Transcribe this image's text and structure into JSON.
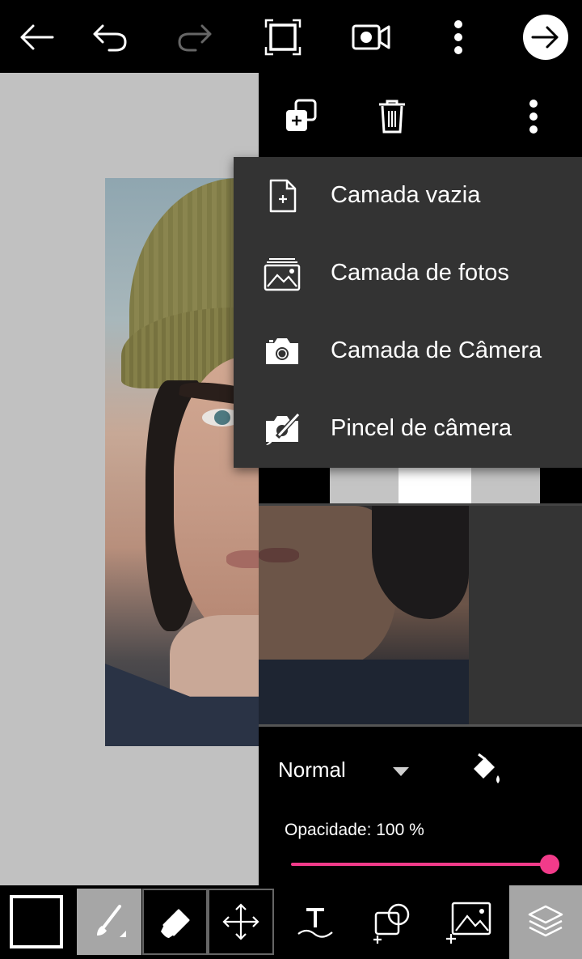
{
  "toolbar": {
    "back": "back-arrow-icon",
    "undo": "undo-icon",
    "redo": "redo-icon",
    "fullscreen": "fullscreen-icon",
    "record": "video-record-icon",
    "more": "more-vertical-icon",
    "next": "next-arrow-icon"
  },
  "layer_toolbar": {
    "add_layer": "add-layer-icon",
    "delete_layer": "trash-icon",
    "more": "more-vertical-icon"
  },
  "menu": {
    "items": [
      {
        "label": "Camada vazia",
        "icon": "blank-file-plus-icon"
      },
      {
        "label": "Camada de fotos",
        "icon": "photo-icon"
      },
      {
        "label": "Camada de Câmera",
        "icon": "camera-icon"
      },
      {
        "label": "Pincel de câmera",
        "icon": "camera-brush-icon"
      }
    ]
  },
  "blend": {
    "mode": "Normal",
    "fill_icon": "paint-bucket-icon"
  },
  "opacity": {
    "label": "Opacidade: 100 %",
    "value": 100
  },
  "colors": {
    "accent": "#f23b8a",
    "menu_bg": "#333333",
    "canvas_bg": "#c1c1c1",
    "active_tool_bg": "#a6a6a6",
    "primary_color": "#000000"
  },
  "bottom_tools": [
    {
      "name": "color-swatch"
    },
    {
      "name": "brush-icon",
      "active": true
    },
    {
      "name": "eraser-icon"
    },
    {
      "name": "move-icon"
    },
    {
      "name": "text-icon"
    },
    {
      "name": "shape-add-icon"
    },
    {
      "name": "image-add-icon"
    },
    {
      "name": "layers-icon",
      "active": true
    }
  ]
}
